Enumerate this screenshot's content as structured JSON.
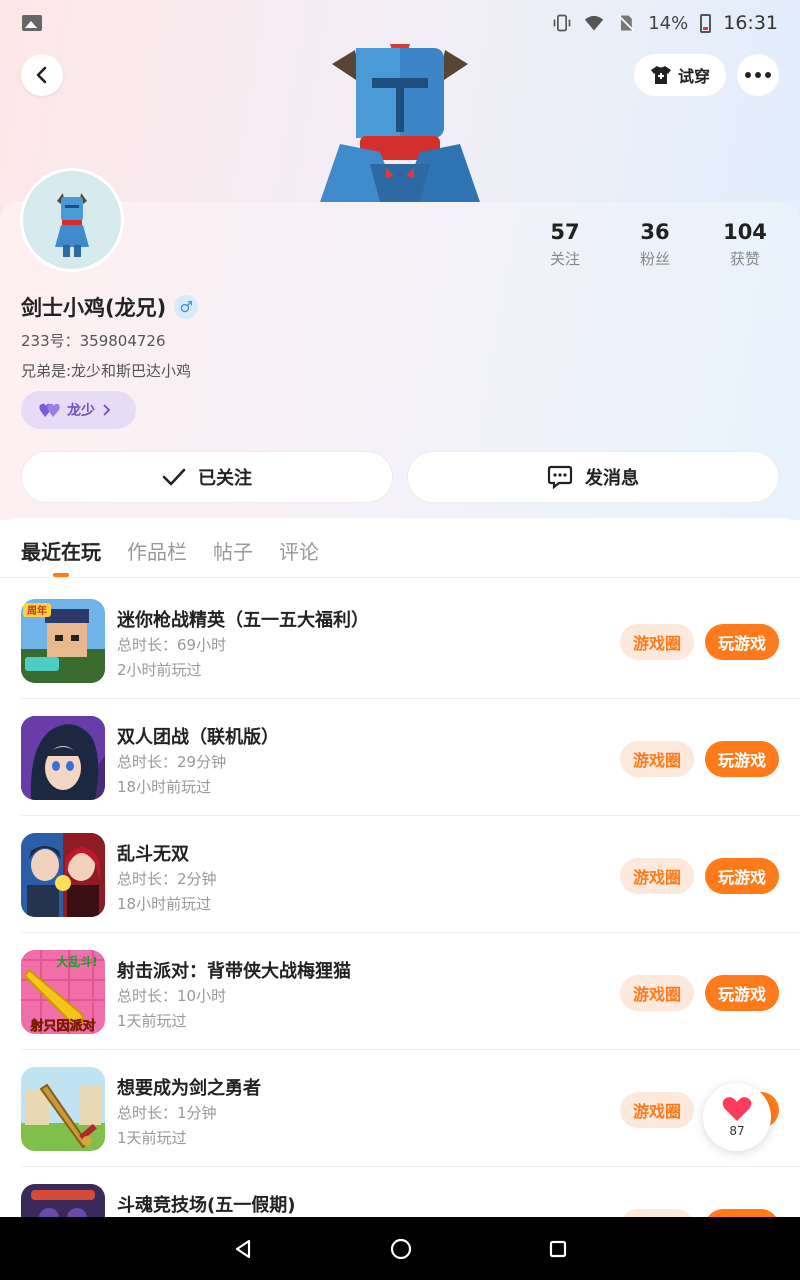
{
  "status_bar": {
    "battery": "14%",
    "time": "16:31"
  },
  "header": {
    "tryon_label": "试穿"
  },
  "profile": {
    "name": "剑士小鸡(龙兄)",
    "gender_symbol": "♂",
    "uid": "233号：359804726",
    "bio": "兄弟是:龙少和斯巴达小鸡",
    "relation_tag": "龙少",
    "stats": [
      {
        "num": "57",
        "label": "关注"
      },
      {
        "num": "36",
        "label": "粉丝"
      },
      {
        "num": "104",
        "label": "获赞"
      }
    ],
    "follow_label": "已关注",
    "message_label": "发消息"
  },
  "tabs": [
    "最近在玩",
    "作品栏",
    "帖子",
    "评论"
  ],
  "game_buttons": {
    "circle": "游戏圈",
    "play": "玩游戏"
  },
  "games": [
    {
      "title": "迷你枪战精英（五一五大福利）",
      "duration": "总时长：69小时",
      "last": "2小时前玩过"
    },
    {
      "title": "双人团战（联机版）",
      "duration": "总时长：29分钟",
      "last": "18小时前玩过"
    },
    {
      "title": "乱斗无双",
      "duration": "总时长：2分钟",
      "last": "18小时前玩过"
    },
    {
      "title": "射击派对：背带侠大战梅狸猫",
      "duration": "总时长：10小时",
      "last": "1天前玩过"
    },
    {
      "title": "想要成为剑之勇者",
      "duration": "总时长：1分钟",
      "last": "1天前玩过"
    },
    {
      "title": "斗魂竞技场(五一假期)",
      "duration": "",
      "last": ""
    }
  ],
  "game_icon_text": {
    "icon1_badge": "周年",
    "icon4_top": "大乱斗!",
    "icon4_bottom": "射只因派对"
  },
  "float_like": {
    "count": "87"
  },
  "colors": {
    "accent": "#ff7a1a",
    "accent_soft": "#fde8dc",
    "relation_bg": "#e6dcf6",
    "relation_text": "#6b4fc5",
    "gender": "#3d8fe0"
  }
}
